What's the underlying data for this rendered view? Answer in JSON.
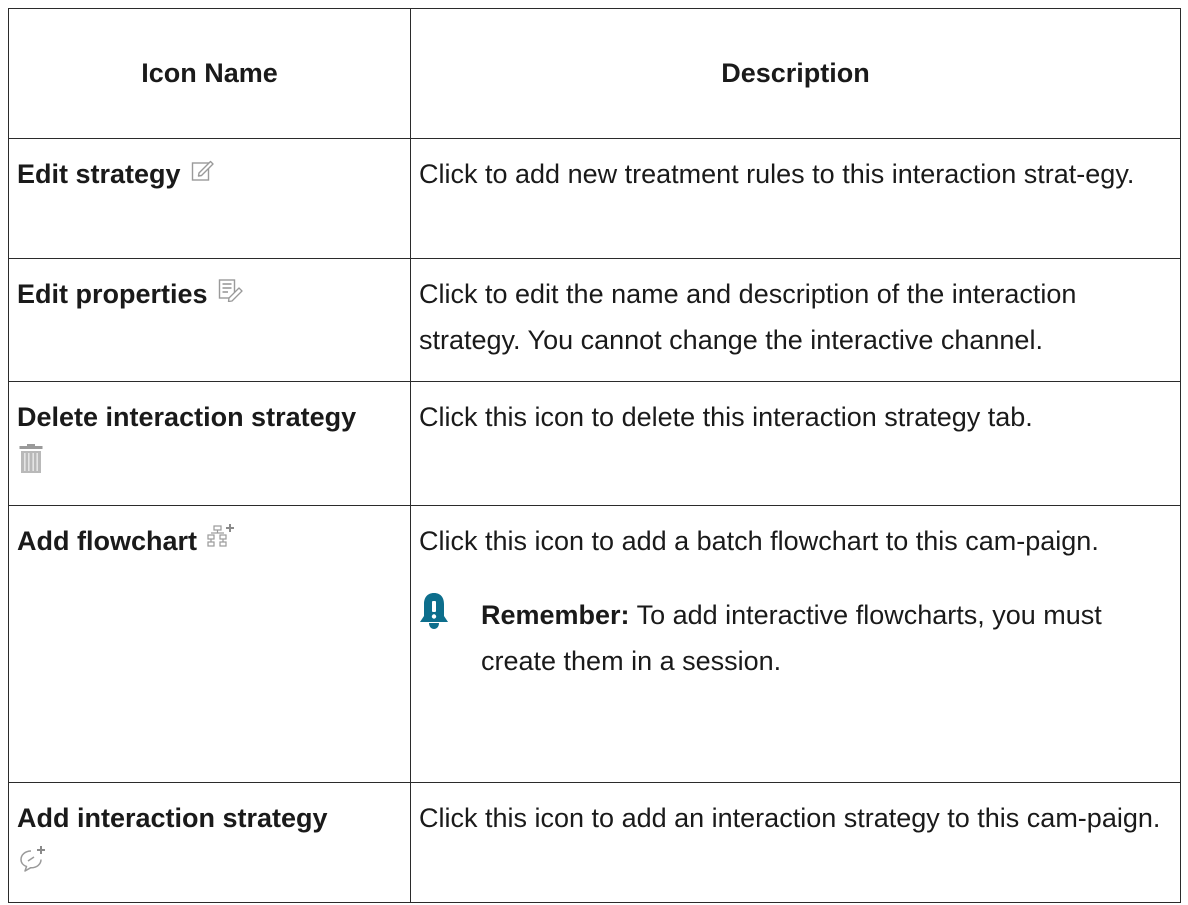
{
  "table": {
    "headers": {
      "icon_name": "Icon Name",
      "description": "Description"
    },
    "rows": [
      {
        "name": "Edit strategy",
        "icon": "edit-pencil-icon",
        "description": "Click to add new treatment rules to this interaction strat-egy."
      },
      {
        "name": "Edit properties",
        "icon": "edit-properties-icon",
        "description": "Click to edit the name and description of the interaction strategy. You cannot change the interactive channel."
      },
      {
        "name": "Delete interaction strategy",
        "icon": "trash-icon",
        "description": "Click this icon to delete this interaction strategy tab."
      },
      {
        "name": "Add flowchart",
        "icon": "add-flowchart-icon",
        "description": "Click this icon to add a batch flowchart to this cam-paign.",
        "note": {
          "icon": "bell-icon",
          "label": "Remember:",
          "text": " To add interactive flowcharts, you must create them in a session."
        }
      },
      {
        "name": "Add interaction strategy",
        "icon": "add-interaction-strategy-icon",
        "description": "Click this icon to add an interaction strategy to this cam-paign."
      }
    ]
  },
  "colors": {
    "border": "#2b2b2b",
    "icon_gray": "#9a9a9a",
    "bell": "#0d6e8c"
  }
}
